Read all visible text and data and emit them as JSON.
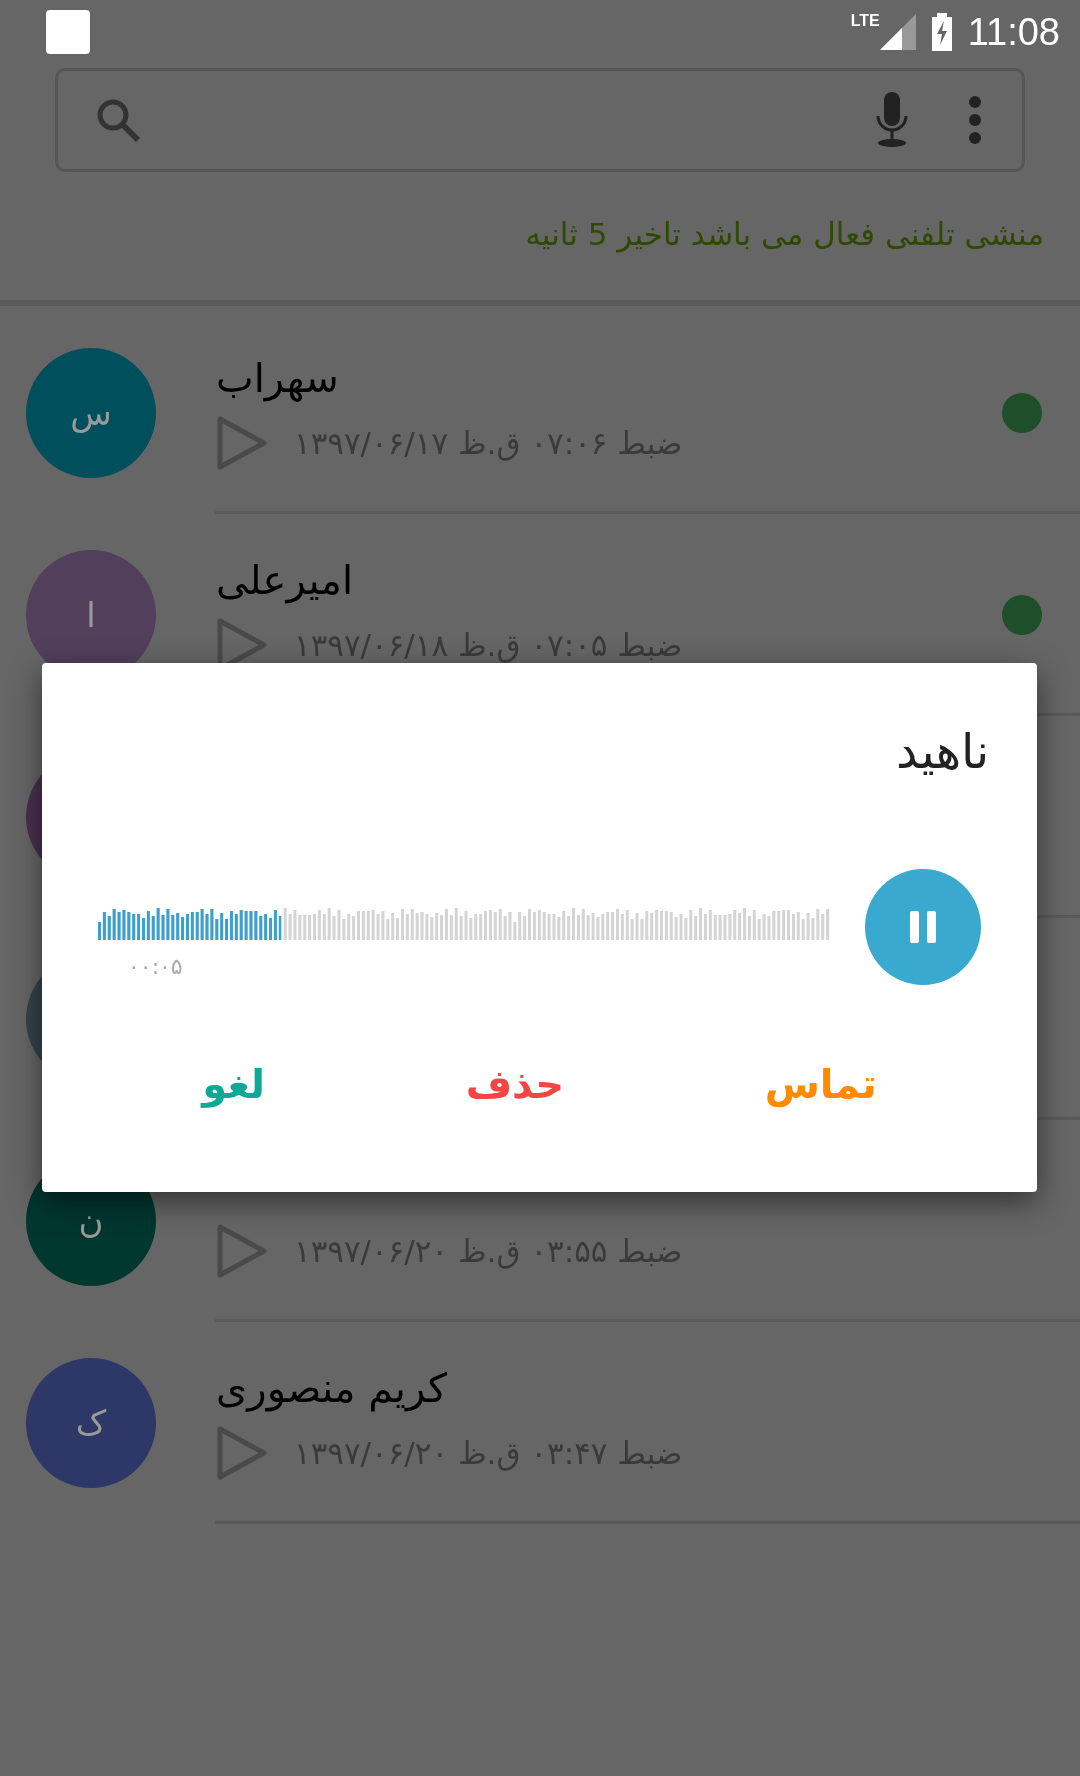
{
  "status_bar": {
    "network": "LTE",
    "time": "11:08"
  },
  "notice": "منشی تلفنی فعال می باشد تاخیر 5 ثانیه",
  "recordings": [
    {
      "name": "سهراب",
      "initial": "س",
      "color": "#004f5c",
      "date": "ضبط ۰۷:۰۶ ق.ظ ۱۳۹۷/۰۶/۱۷",
      "new": true
    },
    {
      "name": "امیرعلی",
      "initial": "ا",
      "color": "#523f5c",
      "date": "ضبط ۰۷:۰۵ ق.ظ ۱۳۹۷/۰۶/۱۸",
      "new": true
    },
    {
      "color": "#4a3050",
      "new": false
    },
    {
      "color": "#33454a",
      "new": false
    },
    {
      "initial": "ن",
      "color": "#00372f",
      "date": "ضبط ۰۳:۵۵ ق.ظ ۱۳۹۷/۰۶/۲۰",
      "new": false
    },
    {
      "name": "کریم منصوری",
      "initial": "ک",
      "color": "#2d3868",
      "date": "ضبط ۰۳:۴۷ ق.ظ ۱۳۹۷/۰۶/۲۰",
      "new": false
    }
  ],
  "dialog": {
    "title": "ناهید",
    "player": {
      "playing": true,
      "level": 0.25,
      "time": "۰۰:۰۵"
    },
    "buttons": [
      {
        "label": "تماس",
        "kind": "call"
      },
      {
        "label": "حذف",
        "kind": "delete"
      },
      {
        "label": "لغو",
        "kind": "cancel"
      }
    ]
  }
}
